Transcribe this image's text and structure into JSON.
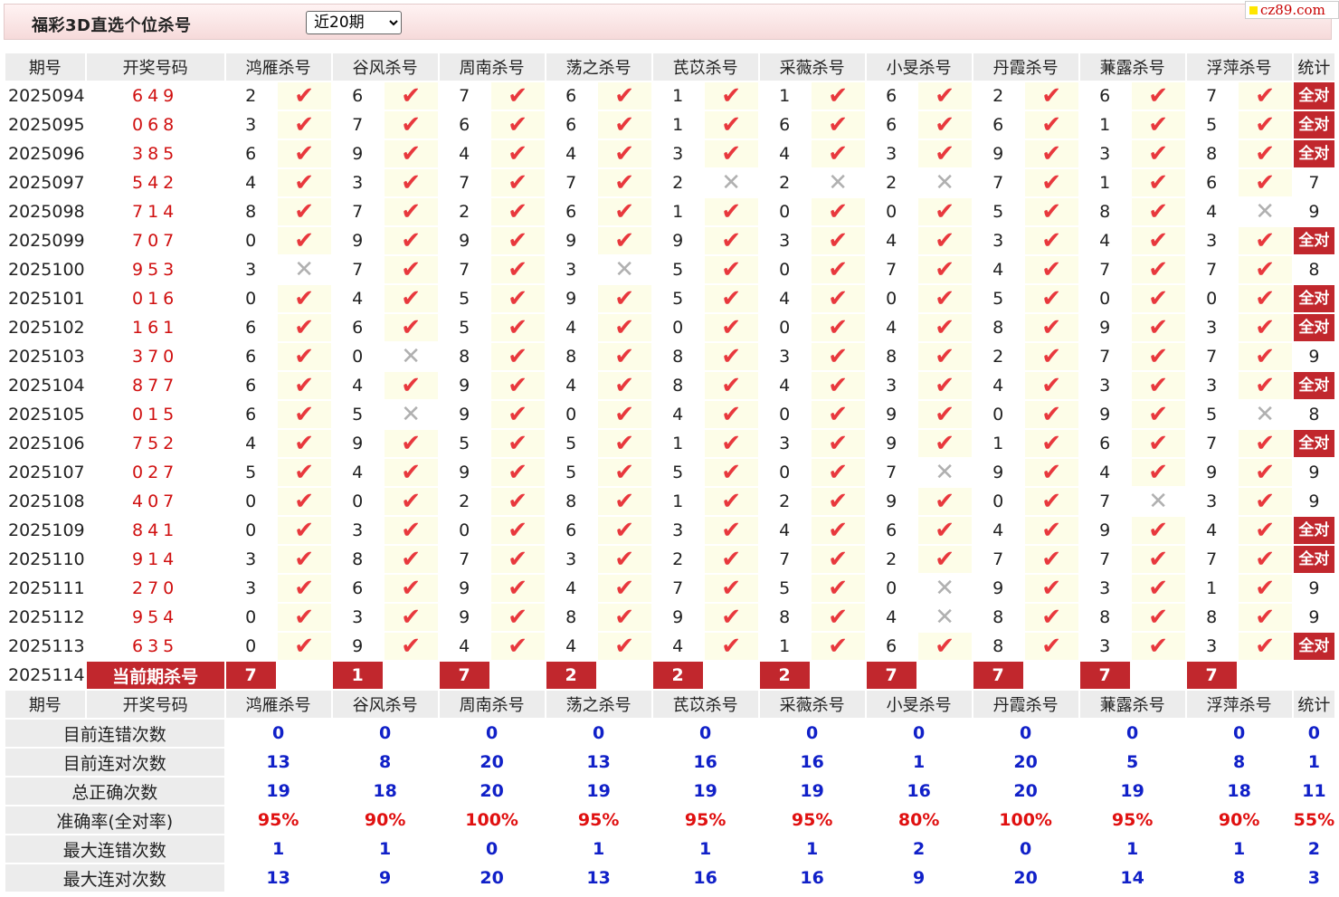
{
  "toolbar": {
    "title": "福彩3D直选个位杀号",
    "period_selected": "近20期",
    "site_badge": "cz89.com"
  },
  "headers": [
    "期号",
    "开奖号码",
    "鸿雁杀号",
    "谷风杀号",
    "周南杀号",
    "荡之杀号",
    "芪苡杀号",
    "采薇杀号",
    "小旻杀号",
    "丹霞杀号",
    "蒹露杀号",
    "浮萍杀号",
    "统计"
  ],
  "experts": [
    "鸿雁",
    "谷风",
    "周南",
    "荡之",
    "芪苡",
    "采薇",
    "小旻",
    "丹霞",
    "蒹露",
    "浮萍"
  ],
  "all_right_label": "全对",
  "rows": [
    {
      "issue": "2025094",
      "draw": "649",
      "kills": [
        2,
        6,
        7,
        6,
        1,
        1,
        6,
        2,
        6,
        7
      ],
      "hits": [
        1,
        1,
        1,
        1,
        1,
        1,
        1,
        1,
        1,
        1
      ],
      "stat": "全对"
    },
    {
      "issue": "2025095",
      "draw": "068",
      "kills": [
        3,
        7,
        6,
        6,
        1,
        6,
        6,
        6,
        1,
        5
      ],
      "hits": [
        1,
        1,
        1,
        1,
        1,
        1,
        1,
        1,
        1,
        1
      ],
      "stat": "全对"
    },
    {
      "issue": "2025096",
      "draw": "385",
      "kills": [
        6,
        9,
        4,
        4,
        3,
        4,
        3,
        9,
        3,
        8
      ],
      "hits": [
        1,
        1,
        1,
        1,
        1,
        1,
        1,
        1,
        1,
        1
      ],
      "stat": "全对"
    },
    {
      "issue": "2025097",
      "draw": "542",
      "kills": [
        4,
        3,
        7,
        7,
        2,
        2,
        2,
        7,
        1,
        6
      ],
      "hits": [
        1,
        1,
        1,
        1,
        0,
        0,
        0,
        1,
        1,
        1
      ],
      "stat": "7"
    },
    {
      "issue": "2025098",
      "draw": "714",
      "kills": [
        8,
        7,
        2,
        6,
        1,
        0,
        0,
        5,
        8,
        4
      ],
      "hits": [
        1,
        1,
        1,
        1,
        1,
        1,
        1,
        1,
        1,
        0
      ],
      "stat": "9"
    },
    {
      "issue": "2025099",
      "draw": "707",
      "kills": [
        0,
        9,
        9,
        9,
        9,
        3,
        4,
        3,
        4,
        3
      ],
      "hits": [
        1,
        1,
        1,
        1,
        1,
        1,
        1,
        1,
        1,
        1
      ],
      "stat": "全对"
    },
    {
      "issue": "2025100",
      "draw": "953",
      "kills": [
        3,
        7,
        7,
        3,
        5,
        0,
        7,
        4,
        7,
        7
      ],
      "hits": [
        0,
        1,
        1,
        0,
        1,
        1,
        1,
        1,
        1,
        1
      ],
      "stat": "8"
    },
    {
      "issue": "2025101",
      "draw": "016",
      "kills": [
        0,
        4,
        5,
        9,
        5,
        4,
        0,
        5,
        0,
        0
      ],
      "hits": [
        1,
        1,
        1,
        1,
        1,
        1,
        1,
        1,
        1,
        1
      ],
      "stat": "全对"
    },
    {
      "issue": "2025102",
      "draw": "161",
      "kills": [
        6,
        6,
        5,
        4,
        0,
        0,
        4,
        8,
        9,
        3
      ],
      "hits": [
        1,
        1,
        1,
        1,
        1,
        1,
        1,
        1,
        1,
        1
      ],
      "stat": "全对"
    },
    {
      "issue": "2025103",
      "draw": "370",
      "kills": [
        6,
        0,
        8,
        8,
        8,
        3,
        8,
        2,
        7,
        7
      ],
      "hits": [
        1,
        0,
        1,
        1,
        1,
        1,
        1,
        1,
        1,
        1
      ],
      "stat": "9"
    },
    {
      "issue": "2025104",
      "draw": "877",
      "kills": [
        6,
        4,
        9,
        4,
        8,
        4,
        3,
        4,
        3,
        3
      ],
      "hits": [
        1,
        1,
        1,
        1,
        1,
        1,
        1,
        1,
        1,
        1
      ],
      "stat": "全对"
    },
    {
      "issue": "2025105",
      "draw": "015",
      "kills": [
        6,
        5,
        9,
        0,
        4,
        0,
        9,
        0,
        9,
        5
      ],
      "hits": [
        1,
        0,
        1,
        1,
        1,
        1,
        1,
        1,
        1,
        0
      ],
      "stat": "8"
    },
    {
      "issue": "2025106",
      "draw": "752",
      "kills": [
        4,
        9,
        5,
        5,
        1,
        3,
        9,
        1,
        6,
        7
      ],
      "hits": [
        1,
        1,
        1,
        1,
        1,
        1,
        1,
        1,
        1,
        1
      ],
      "stat": "全对"
    },
    {
      "issue": "2025107",
      "draw": "027",
      "kills": [
        5,
        4,
        9,
        5,
        5,
        0,
        7,
        9,
        4,
        9
      ],
      "hits": [
        1,
        1,
        1,
        1,
        1,
        1,
        0,
        1,
        1,
        1
      ],
      "stat": "9"
    },
    {
      "issue": "2025108",
      "draw": "407",
      "kills": [
        0,
        0,
        2,
        8,
        1,
        2,
        9,
        0,
        7,
        3
      ],
      "hits": [
        1,
        1,
        1,
        1,
        1,
        1,
        1,
        1,
        0,
        1
      ],
      "stat": "9"
    },
    {
      "issue": "2025109",
      "draw": "841",
      "kills": [
        0,
        3,
        0,
        6,
        3,
        4,
        6,
        4,
        9,
        4
      ],
      "hits": [
        1,
        1,
        1,
        1,
        1,
        1,
        1,
        1,
        1,
        1
      ],
      "stat": "全对"
    },
    {
      "issue": "2025110",
      "draw": "914",
      "kills": [
        3,
        8,
        7,
        3,
        2,
        7,
        2,
        7,
        7,
        7
      ],
      "hits": [
        1,
        1,
        1,
        1,
        1,
        1,
        1,
        1,
        1,
        1
      ],
      "stat": "全对"
    },
    {
      "issue": "2025111",
      "draw": "270",
      "kills": [
        3,
        6,
        9,
        4,
        7,
        5,
        0,
        9,
        3,
        1
      ],
      "hits": [
        1,
        1,
        1,
        1,
        1,
        1,
        0,
        1,
        1,
        1
      ],
      "stat": "9"
    },
    {
      "issue": "2025112",
      "draw": "954",
      "kills": [
        0,
        3,
        9,
        8,
        9,
        8,
        4,
        8,
        8,
        8
      ],
      "hits": [
        1,
        1,
        1,
        1,
        1,
        1,
        0,
        1,
        1,
        1
      ],
      "stat": "9"
    },
    {
      "issue": "2025113",
      "draw": "635",
      "kills": [
        0,
        9,
        4,
        4,
        4,
        1,
        6,
        8,
        3,
        3
      ],
      "hits": [
        1,
        1,
        1,
        1,
        1,
        1,
        1,
        1,
        1,
        1
      ],
      "stat": "全对"
    }
  ],
  "current": {
    "issue": "2025114",
    "label": "当前期杀号",
    "kills": [
      7,
      1,
      7,
      2,
      2,
      2,
      7,
      7,
      7,
      7
    ]
  },
  "stats": [
    {
      "label": "目前连错次数",
      "values": [
        "0",
        "0",
        "0",
        "0",
        "0",
        "0",
        "0",
        "0",
        "0",
        "0",
        "0"
      ],
      "pct": false
    },
    {
      "label": "目前连对次数",
      "values": [
        "13",
        "8",
        "20",
        "13",
        "16",
        "16",
        "1",
        "20",
        "5",
        "8",
        "1"
      ],
      "pct": false
    },
    {
      "label": "总正确次数",
      "values": [
        "19",
        "18",
        "20",
        "19",
        "19",
        "19",
        "16",
        "20",
        "19",
        "18",
        "11"
      ],
      "pct": false
    },
    {
      "label": "准确率(全对率)",
      "values": [
        "95%",
        "90%",
        "100%",
        "95%",
        "95%",
        "95%",
        "80%",
        "100%",
        "95%",
        "90%",
        "55%"
      ],
      "pct": true
    },
    {
      "label": "最大连错次数",
      "values": [
        "1",
        "1",
        "0",
        "1",
        "1",
        "1",
        "2",
        "0",
        "1",
        "1",
        "2"
      ],
      "pct": false
    },
    {
      "label": "最大连对次数",
      "values": [
        "13",
        "9",
        "20",
        "13",
        "16",
        "16",
        "9",
        "20",
        "14",
        "8",
        "3"
      ],
      "pct": false
    }
  ],
  "colors": {
    "accent": "#c1272d",
    "tick": "#e8383d",
    "cross": "#b0b0b0",
    "stat_blue": "#1020c8",
    "stat_red": "#e01010",
    "hit_bg": "#fdfde8",
    "header_bg": "#ececec"
  }
}
